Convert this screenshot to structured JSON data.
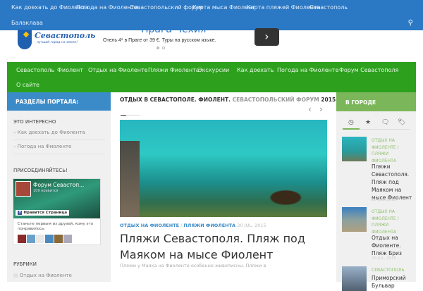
{
  "topnav": {
    "items": [
      "Как доехать до Фиолента",
      "Погода на Фиоленте",
      "Севастопольский форум",
      "Карта мыса Фиолент",
      "Карта пляжей Фиолента",
      "Севастополь",
      "Балаклава"
    ],
    "search_icon": "search-icon"
  },
  "logo": {
    "title": "Севастополь",
    "slogan": "- лучший город на земле!"
  },
  "ad": {
    "title": "Прага  Чехия",
    "text": "Отель 4* в Праге от 39 €. Туры на русском языке.",
    "button": "›"
  },
  "mainnav": {
    "items": [
      "Севастополь",
      "Фиолент",
      "Отдых на Фиоленте",
      "Пляжи Фиолента",
      "Экскурсии",
      "Как доехать",
      "Погода на Фиоленте",
      "Форум Севастополя",
      "О сайте"
    ]
  },
  "left": {
    "header": "РАЗДЕЛЫ ПОРТАЛА:",
    "interesting_title": "ЭТО ИНТЕРЕСНО",
    "links": [
      "– Как доехать до Фиолента",
      "– Погода на Фиоленте"
    ],
    "join_title": "ПРИСОЕДИНЯЙТЕСЬ!",
    "fb": {
      "name": "Форум Севастоп...",
      "likes": "109 нравится",
      "like_button": "Нравится Страница",
      "text": "Станьте первым из друзей, кому это понравилось."
    },
    "rubrics_title": "РУБРИКИ",
    "rubrics": [
      "Отдых на Фиоленте"
    ]
  },
  "center": {
    "header_bold": "ОТДЫХ В СЕВАСТОПОЛЕ. ФИОЛЕНТ.",
    "header_gray": "СЕВАСТОПОЛЬСКИЙ ФОРУМ",
    "header_year": "2015",
    "prev": "‹",
    "next": "›",
    "post": {
      "cat1": "ОТДЫХ НА ФИОЛЕНТЕ",
      "sep": " / ",
      "cat2": "ПЛЯЖИ ФИОЛЕНТА",
      "date": "20 JUL, 2015",
      "title": "Пляжи Севастополя. Пляж под Маяком на мысе Фиолент",
      "excerpt": "Пляжи у Маяка на Фиоленте особенно живописны. Пляжи в"
    }
  },
  "right": {
    "header": "В ГОРОДЕ",
    "tabs": [
      "◷",
      "★",
      "🗨",
      "🏷"
    ],
    "posts": [
      {
        "cat": "ОТДЫХ НА ФИОЛЕНТЕ / ПЛЯЖИ ФИОЛЕНТА",
        "title": "Пляжи Севастополя. Пляж под Маяком на мысе Фиолент",
        "date": "20 JUL, 2015"
      },
      {
        "cat": "ОТДЫХ НА ФИОЛЕНТЕ / ПЛЯЖИ ФИОЛЕНТА",
        "title": "Отдых на Фиоленте. Пляж Бриз",
        "date": "20 JUL, 2015"
      },
      {
        "cat": "СЕВАСТОПОЛЬ",
        "title": "Приморский Бульвар",
        "date": ""
      }
    ]
  }
}
